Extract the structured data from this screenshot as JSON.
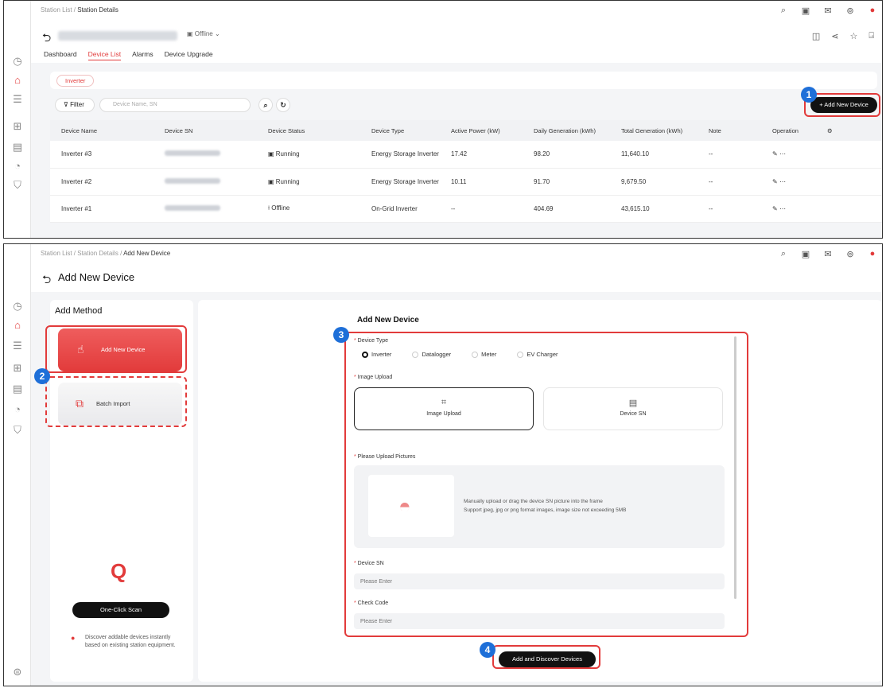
{
  "device_list_page": {
    "breadcrumb": {
      "root": "Station List",
      "sep": " / ",
      "current": "Station Details"
    },
    "status": "Offline",
    "tabs": [
      "Dashboard",
      "Device List",
      "Alarms",
      "Device Upgrade"
    ],
    "category_chip": "Inverter",
    "filter_label": "Filter",
    "search_placeholder": "Device Name, SN",
    "add_button": "+ Add New Device",
    "columns": [
      "Device Name",
      "Device SN",
      "Device Status",
      "Device Type",
      "Active Power (kW)",
      "Daily Generation (kWh)",
      "Total Generation (kWh)",
      "Note",
      "Operation"
    ],
    "rows": [
      {
        "name": "Inverter #3",
        "status": "Running",
        "type": "Energy Storage Inverter",
        "active_power": "17.42",
        "daily": "98.20",
        "total": "11,640.10",
        "note": "--"
      },
      {
        "name": "Inverter #2",
        "status": "Running",
        "type": "Energy Storage Inverter",
        "active_power": "10.11",
        "daily": "91.70",
        "total": "9,679.50",
        "note": "--"
      },
      {
        "name": "Inverter #1",
        "status": "Offline",
        "type": "On-Grid Inverter",
        "active_power": "--",
        "daily": "404.69",
        "total": "43,615.10",
        "note": "--"
      }
    ]
  },
  "add_device_page": {
    "breadcrumb": {
      "root": "Station List",
      "mid": "Station Details",
      "current": "Add New Device",
      "sep": " / "
    },
    "title": "Add New Device",
    "add_method_heading": "Add Method",
    "method_add": "Add New Device",
    "method_batch": "Batch Import",
    "scan_button": "One-Click Scan",
    "scan_note": "Discover addable devices instantly based on existing station equipment.",
    "form_title": "Add New Device",
    "device_type_label": "Device Type",
    "device_types": [
      "Inverter",
      "Datalogger",
      "Meter",
      "EV Charger"
    ],
    "image_upload_label": "Image Upload",
    "upload_options": [
      "Image Upload",
      "Device SN"
    ],
    "upload_pictures_label": "Please Upload Pictures",
    "drop_text_1": "Manually upload or drag the device SN picture into the frame",
    "drop_text_2": "Support jpeg, jpg or png format images, image size not exceeding 5MB",
    "device_sn_label": "Device SN",
    "device_sn_placeholder": "Please Enter",
    "check_code_label": "Check Code",
    "check_code_placeholder": "Please Enter",
    "submit_button": "Add and Discover Devices"
  },
  "badges": [
    "1",
    "2",
    "3",
    "4"
  ],
  "colors": {
    "accent": "#e23b3b",
    "badge": "#1e6fd8",
    "running": "#3aa55a"
  }
}
